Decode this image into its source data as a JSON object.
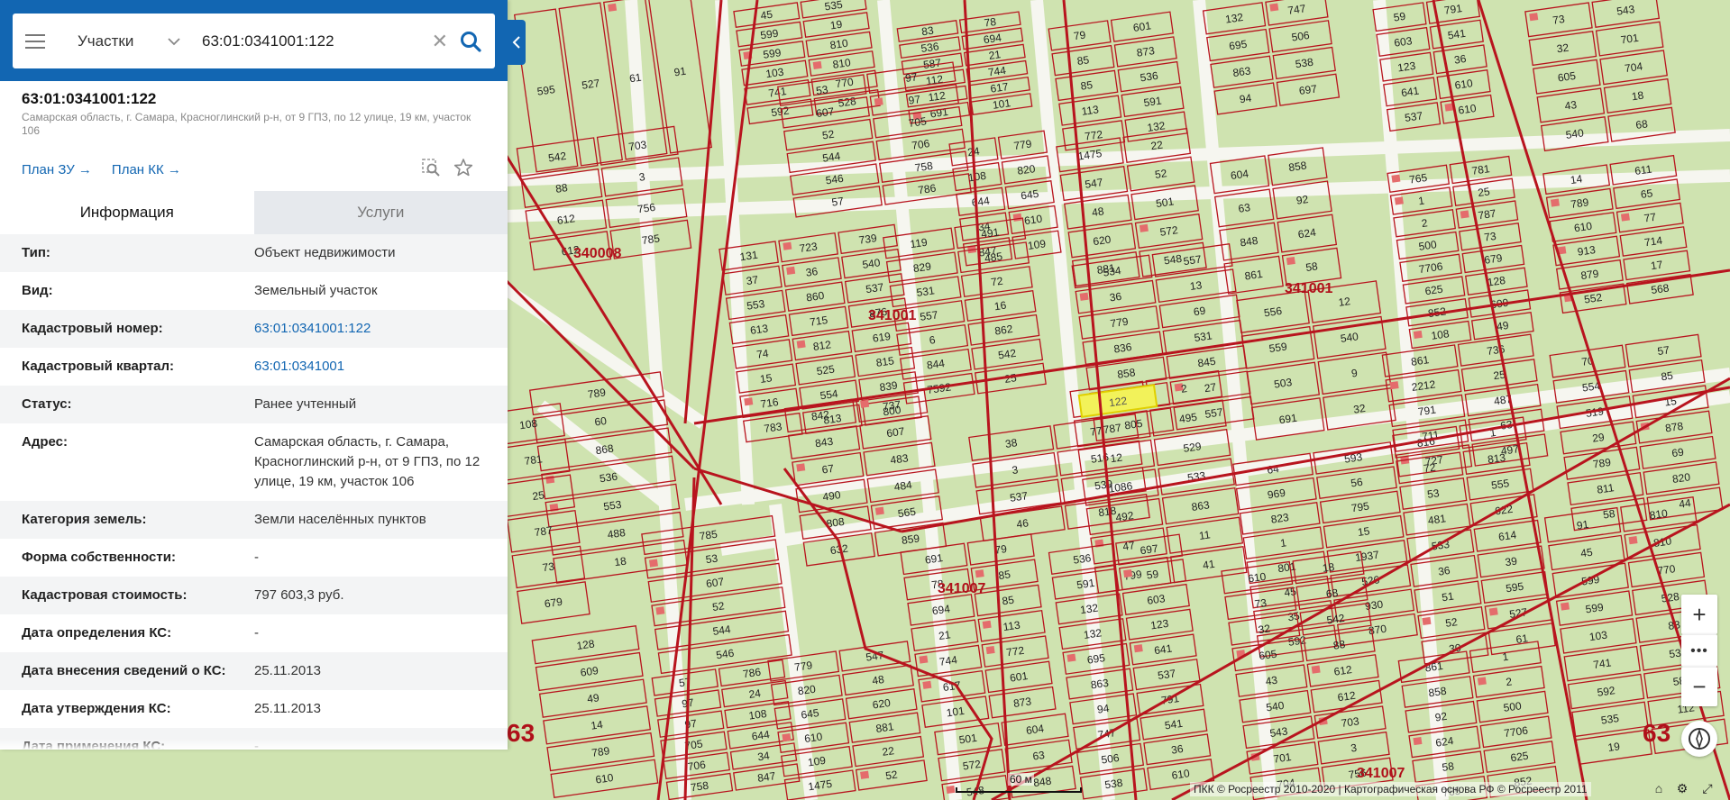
{
  "search": {
    "category": "Участки",
    "query": "63:01:0341001:122"
  },
  "object": {
    "title": "63:01:0341001:122",
    "address_short": "Самарская область, г. Самара, Красноглинский р-н, от 9 ГПЗ, по 12 улице, 19 км, участок 106",
    "links": [
      "План ЗУ →",
      "План КК →"
    ]
  },
  "tabs": {
    "info": "Информация",
    "services": "Услуги"
  },
  "info_rows": [
    {
      "key": "Тип:",
      "value": "Объект недвижимости"
    },
    {
      "key": "Вид:",
      "value": "Земельный участок"
    },
    {
      "key": "Кадастровый номер:",
      "value": "63:01:0341001:122",
      "link": true
    },
    {
      "key": "Кадастровый квартал:",
      "value": "63:01:0341001",
      "link": true
    },
    {
      "key": "Статус:",
      "value": "Ранее учтенный"
    },
    {
      "key": "Адрес:",
      "value": "Самарская область, г. Самара, Красноглинский р-н, от 9 ГПЗ, по 12 улице, 19 км, участок 106"
    },
    {
      "key": "Категория земель:",
      "value": "Земли населённых пунктов"
    },
    {
      "key": "Форма собственности:",
      "value": "-"
    },
    {
      "key": "Кадастровая стоимость:",
      "value": "797 603,3 руб."
    },
    {
      "key": "Дата определения КС:",
      "value": "-"
    },
    {
      "key": "Дата внесения сведений о КС:",
      "value": "25.11.2013"
    },
    {
      "key": "Дата утверждения КС:",
      "value": "25.11.2013"
    },
    {
      "key": "Дата применения КС:",
      "value": "-"
    }
  ],
  "map": {
    "quarter_labels": [
      "340008",
      "341001",
      "341001",
      "341007",
      "341007"
    ],
    "edge_numbers": [
      "63",
      "63"
    ],
    "highlighted_parcel": "122",
    "parcel_labels": [
      "595",
      "527",
      "61",
      "91",
      "45",
      "599",
      "599",
      "103",
      "741",
      "592",
      "535",
      "19",
      "810",
      "810",
      "770",
      "528",
      "83",
      "536",
      "587",
      "112",
      "112",
      "691",
      "78",
      "694",
      "21",
      "744",
      "617",
      "101",
      "79",
      "85",
      "85",
      "113",
      "772",
      "601",
      "873",
      "536",
      "591",
      "132",
      "132",
      "695",
      "863",
      "94",
      "747",
      "506",
      "538",
      "697",
      "59",
      "603",
      "123",
      "641",
      "537",
      "791",
      "541",
      "36",
      "610",
      "610",
      "73",
      "32",
      "605",
      "43",
      "540",
      "543",
      "701",
      "704",
      "18",
      "68",
      "542",
      "88",
      "612",
      "612",
      "703",
      "3",
      "756",
      "785",
      "53",
      "607",
      "52",
      "544",
      "546",
      "57",
      "97",
      "97",
      "705",
      "706",
      "758",
      "786",
      "24",
      "108",
      "644",
      "34",
      "847",
      "779",
      "820",
      "645",
      "610",
      "109",
      "1475",
      "547",
      "48",
      "620",
      "881",
      "22",
      "52",
      "501",
      "572",
      "548",
      "604",
      "63",
      "848",
      "861",
      "858",
      "92",
      "624",
      "58",
      "765",
      "1",
      "2",
      "500",
      "7706",
      "625",
      "852",
      "108",
      "781",
      "25",
      "787",
      "73",
      "679",
      "128",
      "609",
      "49",
      "14",
      "789",
      "610",
      "913",
      "879",
      "552",
      "611",
      "65",
      "77",
      "714",
      "17",
      "568",
      "131",
      "37",
      "553",
      "613",
      "74",
      "15",
      "716",
      "783",
      "723",
      "36",
      "860",
      "715",
      "812",
      "525",
      "554",
      "813",
      "739",
      "540",
      "537",
      "876",
      "619",
      "815",
      "839",
      "800",
      "119",
      "829",
      "531",
      "557",
      "6",
      "844",
      "7592",
      "491",
      "485",
      "72",
      "16",
      "862",
      "542",
      "25",
      "534",
      "36",
      "779",
      "836",
      "858",
      "89",
      "805",
      "557",
      "13",
      "69",
      "531",
      "845",
      "27",
      "557",
      "556",
      "559",
      "503",
      "691",
      "12",
      "540",
      "9",
      "32",
      "861",
      "2212",
      "791",
      "711",
      "727",
      "736",
      "25",
      "487",
      "63",
      "497",
      "70",
      "554",
      "519",
      "29",
      "789",
      "811",
      "58",
      "57",
      "85",
      "15",
      "878",
      "69",
      "820",
      "44",
      "789",
      "60",
      "868",
      "536",
      "553",
      "488",
      "18",
      "842",
      "843",
      "67",
      "490",
      "808",
      "632",
      "737",
      "607",
      "483",
      "484",
      "565",
      "859",
      "38",
      "3",
      "537",
      "46",
      "77",
      "516",
      "539",
      "818",
      "560",
      "787",
      "12",
      "1086",
      "492",
      "47",
      "799",
      "2",
      "495",
      "529",
      "533",
      "863",
      "11",
      "41",
      "64",
      "969",
      "823",
      "1",
      "801",
      "45",
      "35",
      "592",
      "593",
      "56",
      "795",
      "15",
      "1937",
      "526",
      "930",
      "870",
      "816",
      "72",
      "53",
      "481",
      "533",
      "36",
      "51",
      "52",
      "30",
      "1",
      "813",
      "555",
      "622",
      "614",
      "39"
    ]
  },
  "controls": {
    "zoom_in": "+",
    "zoom_more": "•••",
    "zoom_out": "−"
  },
  "scale_label": "60 м",
  "attribution": "ПКК © Росреестр 2010-2020 | Картографическая основа РФ © Росреестр 2011"
}
